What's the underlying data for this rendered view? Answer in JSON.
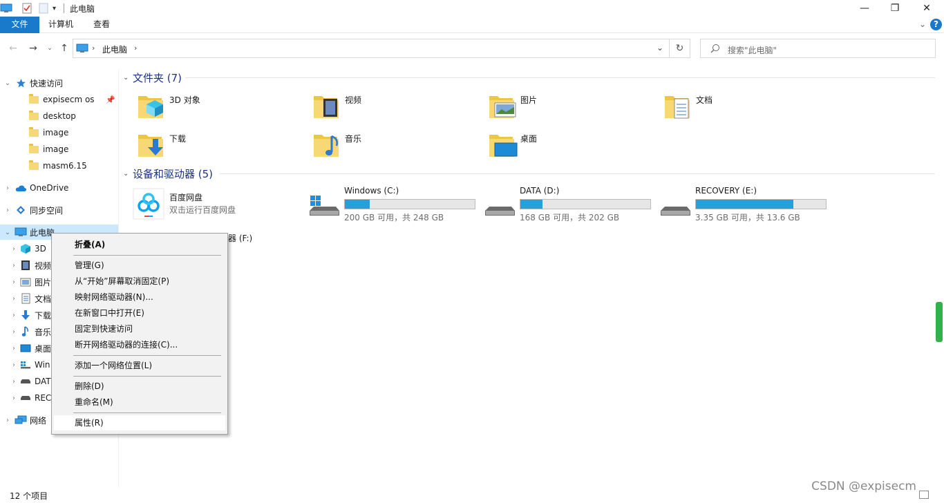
{
  "window": {
    "title": "此电脑",
    "minimize_glyph": "—",
    "maximize_glyph": "❐",
    "close_glyph": "✕"
  },
  "ribbon": {
    "tabs": [
      "文件",
      "计算机",
      "查看"
    ],
    "help": "?"
  },
  "nav": {
    "breadcrumb": "此电脑",
    "search_placeholder": "搜索\"此电脑\""
  },
  "sidebar": {
    "quick_access": "快速访问",
    "pinned": [
      "expisecm os",
      "desktop",
      "image",
      "image",
      "masm6.15"
    ],
    "onedrive": "OneDrive",
    "sync": "同步空间",
    "this_pc": "此电脑",
    "pc_children": [
      "3D",
      "视频",
      "图片",
      "文档",
      "下载",
      "音乐",
      "桌面",
      "Win",
      "DAT",
      "REC"
    ],
    "network": "网络"
  },
  "folders": {
    "header": "文件夹 (7)",
    "items": [
      "3D 对象",
      "视频",
      "图片",
      "文档",
      "下载",
      "音乐",
      "桌面"
    ]
  },
  "devices": {
    "header": "设备和驱动器 (5)",
    "baidu": {
      "name": "百度网盘",
      "sub": "双击运行百度网盘"
    },
    "drives": [
      {
        "name": "Windows (C:)",
        "free": "200 GB 可用，共 248 GB",
        "used_fraction": 0.19
      },
      {
        "name": "DATA (D:)",
        "free": "168 GB 可用，共 202 GB",
        "used_fraction": 0.17
      },
      {
        "name": "RECOVERY (E:)",
        "free": "3.35 GB 可用，共 13.6 GB",
        "used_fraction": 0.75
      }
    ],
    "partial_device": "器 (F:)"
  },
  "context_menu": {
    "items": [
      "折叠(A)",
      "管理(G)",
      "从“开始”屏幕取消固定(P)",
      "映射网络驱动器(N)...",
      "在新窗口中打开(E)",
      "固定到快速访问",
      "断开网络驱动器的连接(C)...",
      "添加一个网络位置(L)",
      "删除(D)",
      "重命名(M)",
      "属性(R)"
    ]
  },
  "status": {
    "count": "12 个项目"
  },
  "watermark": "CSDN @expisecm",
  "colors": {
    "accent": "#1979ca",
    "selection": "#cce8ff",
    "drive_bar": "#26a0da",
    "header_text": "#1e3287"
  }
}
